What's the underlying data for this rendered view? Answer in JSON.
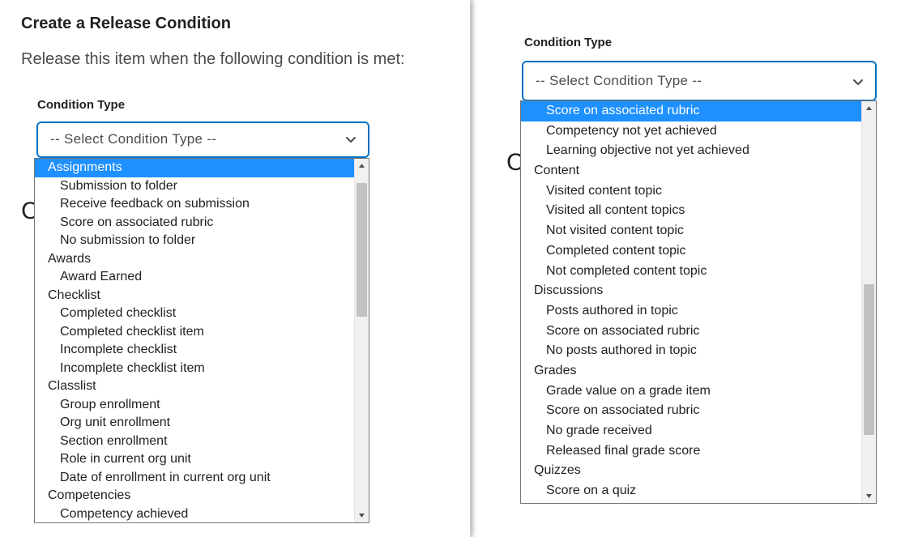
{
  "left": {
    "title": "Create a Release Condition",
    "description": "Release this item when the following condition is met:",
    "condition_label": "Condition Type",
    "select_value": "-- Select Condition Type --",
    "ghost_letter": "C",
    "list": [
      {
        "text": "Assignments",
        "kind": "group",
        "highlighted": true
      },
      {
        "text": "Submission to folder",
        "kind": "opt"
      },
      {
        "text": "Receive feedback on submission",
        "kind": "opt"
      },
      {
        "text": "Score on associated rubric",
        "kind": "opt"
      },
      {
        "text": "No submission to folder",
        "kind": "opt"
      },
      {
        "text": "Awards",
        "kind": "group"
      },
      {
        "text": "Award Earned",
        "kind": "opt"
      },
      {
        "text": "Checklist",
        "kind": "group"
      },
      {
        "text": "Completed checklist",
        "kind": "opt"
      },
      {
        "text": "Completed checklist item",
        "kind": "opt"
      },
      {
        "text": "Incomplete checklist",
        "kind": "opt"
      },
      {
        "text": "Incomplete checklist item",
        "kind": "opt"
      },
      {
        "text": "Classlist",
        "kind": "group"
      },
      {
        "text": "Group enrollment",
        "kind": "opt"
      },
      {
        "text": "Org unit enrollment",
        "kind": "opt"
      },
      {
        "text": "Section enrollment",
        "kind": "opt"
      },
      {
        "text": "Role in current org unit",
        "kind": "opt"
      },
      {
        "text": "Date of enrollment in current org unit",
        "kind": "opt"
      },
      {
        "text": "Competencies",
        "kind": "group"
      },
      {
        "text": "Competency achieved",
        "kind": "opt"
      }
    ]
  },
  "right": {
    "condition_label": "Condition Type",
    "select_value": "-- Select Condition Type --",
    "ghost_letter": "C",
    "list": [
      {
        "text": "Score on associated rubric",
        "kind": "opt",
        "highlighted": true
      },
      {
        "text": "Competency not yet achieved",
        "kind": "opt"
      },
      {
        "text": "Learning objective not yet achieved",
        "kind": "opt"
      },
      {
        "text": "Content",
        "kind": "group"
      },
      {
        "text": "Visited content topic",
        "kind": "opt"
      },
      {
        "text": "Visited all content topics",
        "kind": "opt"
      },
      {
        "text": "Not visited content topic",
        "kind": "opt"
      },
      {
        "text": "Completed content topic",
        "kind": "opt"
      },
      {
        "text": "Not completed content topic",
        "kind": "opt"
      },
      {
        "text": "Discussions",
        "kind": "group"
      },
      {
        "text": "Posts authored in topic",
        "kind": "opt"
      },
      {
        "text": "Score on associated rubric",
        "kind": "opt"
      },
      {
        "text": "No posts authored in topic",
        "kind": "opt"
      },
      {
        "text": "Grades",
        "kind": "group"
      },
      {
        "text": "Grade value on a grade item",
        "kind": "opt"
      },
      {
        "text": "Score on associated rubric",
        "kind": "opt"
      },
      {
        "text": "No grade received",
        "kind": "opt"
      },
      {
        "text": "Released final grade score",
        "kind": "opt"
      },
      {
        "text": "Quizzes",
        "kind": "group"
      },
      {
        "text": "Score on a quiz",
        "kind": "opt"
      }
    ]
  },
  "icons": {
    "chevron": "chevron-down-icon",
    "scroll_up": "scroll-up-arrow-icon",
    "scroll_down": "scroll-down-arrow-icon"
  },
  "colors": {
    "focus_border": "#006fbf",
    "highlight": "#1e90ff"
  }
}
